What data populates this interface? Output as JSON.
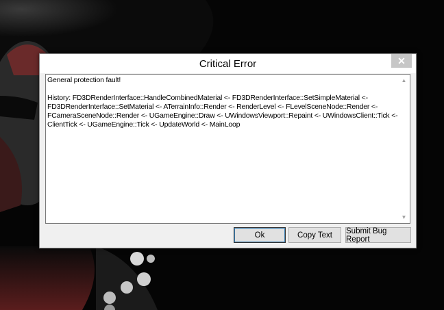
{
  "dialog": {
    "title": "Critical Error",
    "close_icon": "close-icon",
    "message": "General protection fault!\n\nHistory: FD3DRenderInterface::HandleCombinedMaterial <- FD3DRenderInterface::SetSimpleMaterial <- FD3DRenderInterface::SetMaterial <- ATerrainInfo::Render <- RenderLevel <- FLevelSceneNode::Render <- FCameraSceneNode::Render <- UGameEngine::Draw <- UWindowsViewport::Repaint <- UWindowsClient::Tick <- ClientTick <- UGameEngine::Tick <- UpdateWorld <- MainLoop",
    "buttons": {
      "ok": "Ok",
      "copy": "Copy Text",
      "bug": "Submit Bug Report"
    }
  },
  "background": {
    "description_icon": "game-artwork-background"
  },
  "colors": {
    "background": "#050505",
    "dialog": "#f0f0f0",
    "close_button": "#c7c7c7",
    "text": "#000000"
  }
}
